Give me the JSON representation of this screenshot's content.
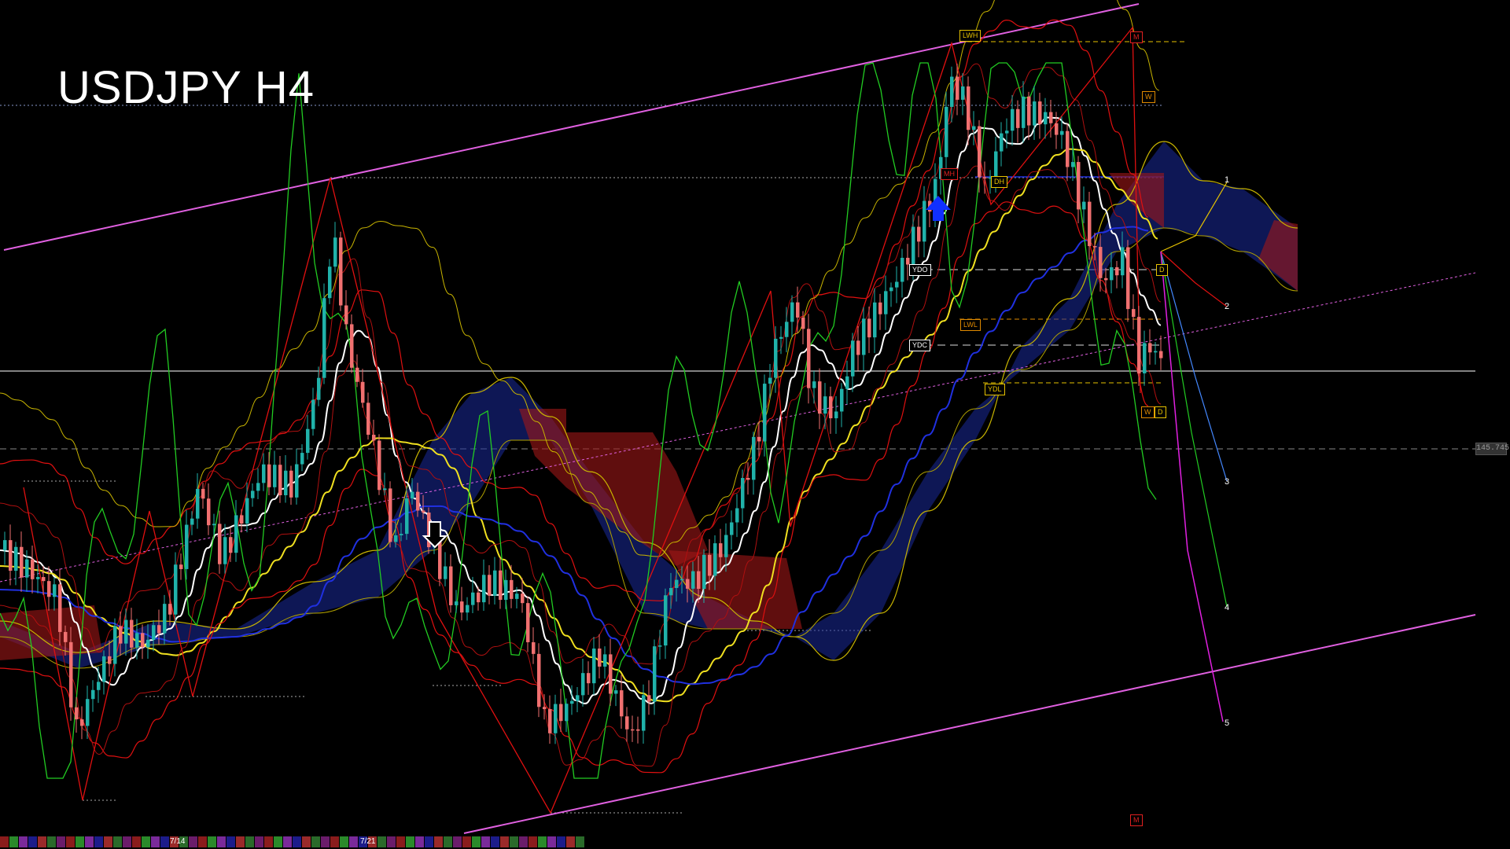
{
  "title": "USDJPY H4",
  "price_label": "145.745",
  "fan_labels": [
    "1",
    "2",
    "3",
    "4",
    "5"
  ],
  "level_labels": {
    "lwh": "LWH",
    "m_top": "M",
    "w_top": "W",
    "dh": "DH",
    "mh": "MH",
    "ydo": "YDO",
    "lwl": "LWL",
    "ydc": "YDC",
    "ydl": "YDL",
    "d_right": "D",
    "w_bottom": "W",
    "d_bottom": "D",
    "m_bottom": "M"
  },
  "time_labels": [
    "7/14",
    "7/21"
  ],
  "colors": {
    "background": "#000000",
    "channel": "#e060e0",
    "bull_candle": "#20b2aa",
    "bear_candle": "#f07070",
    "ma_white": "#ffffff",
    "ma_yellow": "#f0e020",
    "ma_blue": "#2030e0",
    "bollinger": "#e01010",
    "rsi_green": "#22cc22",
    "cloud_blue": "#1a2a9a",
    "cloud_red": "#a01818",
    "span_yellow": "#c8b400"
  }
}
